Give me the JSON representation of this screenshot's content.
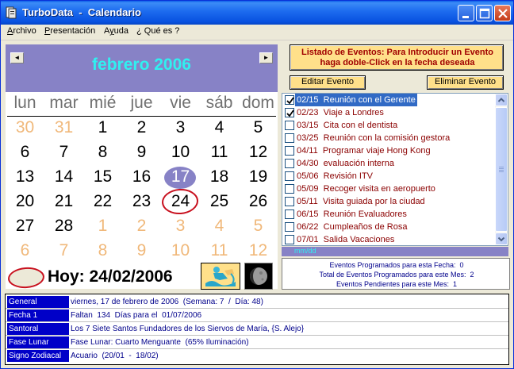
{
  "window": {
    "title": "TurboData  -  Calendario"
  },
  "menu": [
    {
      "label": "Archivo",
      "accel": "A",
      "rest": "rchivo"
    },
    {
      "label": "Presentación",
      "accel": "P",
      "rest": "resentación"
    },
    {
      "label": "Ayuda",
      "accel": "y",
      "pre": "A",
      "rest": "uda"
    },
    {
      "label": "¿ Qué es ?",
      "plain": "¿ Qué es ?"
    }
  ],
  "calendar": {
    "month_title": "febrero 2006",
    "prev_glyph": "◄",
    "next_glyph": "►",
    "weekdays": [
      "lun",
      "mar",
      "mié",
      "jue",
      "vie",
      "sáb",
      "dom"
    ],
    "weeks": [
      [
        "30",
        "31",
        "1",
        "2",
        "3",
        "4",
        "5"
      ],
      [
        "6",
        "7",
        "8",
        "9",
        "10",
        "11",
        "12"
      ],
      [
        "13",
        "14",
        "15",
        "16",
        "17",
        "18",
        "19"
      ],
      [
        "20",
        "21",
        "22",
        "23",
        "24",
        "25",
        "26"
      ],
      [
        "27",
        "28",
        "1",
        "2",
        "3",
        "4",
        "5"
      ],
      [
        "6",
        "7",
        "8",
        "9",
        "10",
        "11",
        "12"
      ]
    ],
    "today_label": "Hoy: 24/02/2006"
  },
  "events_panel": {
    "instructions_line1": "Listado de Eventos:  Para Introducir un Evento",
    "instructions_line2": "haga doble-Click en la fecha deseada",
    "edit_button": "Editar Evento",
    "delete_button": "Eliminar Evento",
    "format_hint": "mm/dd",
    "events": [
      {
        "date": "02/15",
        "text": "Reunión con el Gerente",
        "checked": true,
        "selected": true
      },
      {
        "date": "02/23",
        "text": "Viaje a Londres",
        "checked": true,
        "selected": false
      },
      {
        "date": "03/15",
        "text": "Cita con el dentista",
        "checked": false,
        "selected": false
      },
      {
        "date": "03/25",
        "text": "Reunión con la comisión gestora",
        "checked": false,
        "selected": false
      },
      {
        "date": "04/11",
        "text": "Programar viaje Hong Kong",
        "checked": false,
        "selected": false
      },
      {
        "date": "04/30",
        "text": "evaluación interna",
        "checked": false,
        "selected": false
      },
      {
        "date": "05/06",
        "text": "Revisión ITV",
        "checked": false,
        "selected": false
      },
      {
        "date": "05/09",
        "text": "Recoger visita en aeropuerto",
        "checked": false,
        "selected": false
      },
      {
        "date": "05/11",
        "text": "Visita guiada por la ciudad",
        "checked": false,
        "selected": false
      },
      {
        "date": "06/15",
        "text": "Reunión Evaluadores",
        "checked": false,
        "selected": false
      },
      {
        "date": "06/22",
        "text": "Cumpleaños de Rosa",
        "checked": false,
        "selected": false
      },
      {
        "date": "07/01",
        "text": "Salida Vacaciones",
        "checked": false,
        "selected": false
      }
    ],
    "summary": [
      "Eventos Programados para esta Fecha:  0",
      "Total de Eventos Programados para este Mes:  2",
      "Eventos Pendientes para este Mes:  1"
    ]
  },
  "info": [
    {
      "label": "General",
      "value": "viernes, 17 de febrero de 2006  (Semana: 7  /  Día: 48)"
    },
    {
      "label": "Fecha 1",
      "value": "Faltan  134  Días para el  01/07/2006"
    },
    {
      "label": "Santoral",
      "value": "Los 7 Siete Santos Fundadores de los Siervos de María, {S. Alejo}"
    },
    {
      "label": "Fase Lunar",
      "value": "Fase Lunar: Cuarto Menguante  (65% Iluminación)"
    },
    {
      "label": "Signo Zodiacal",
      "value": "Acuario  (20/01  -  18/02)"
    }
  ],
  "colors": {
    "calendar_header": "#8782c6",
    "month_text": "#30f0f0",
    "other_month_day": "#f0b87a",
    "event_text": "#8b0000",
    "selection": "#316ac5",
    "info_label_bg": "#0000c8",
    "panel_yellow": "#ffe08a"
  }
}
